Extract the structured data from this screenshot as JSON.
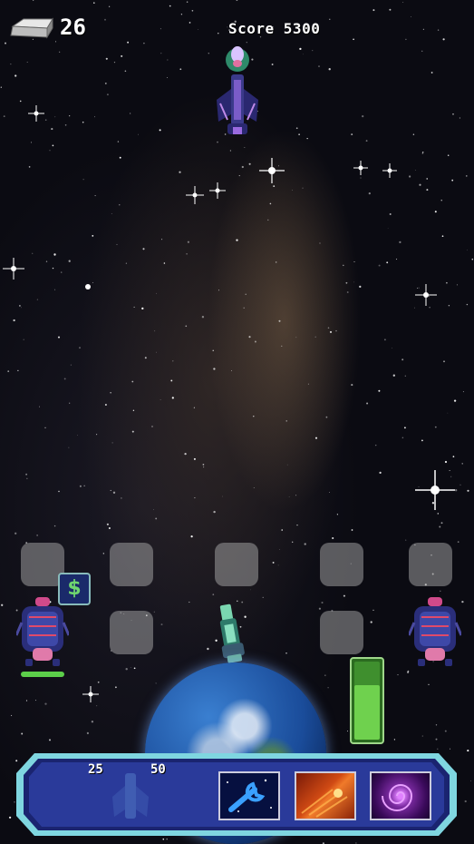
{
  "hud": {
    "silver_icon": "silver-bar-icon",
    "silver_count": "26",
    "score_text": "Score 5300"
  },
  "board": {
    "slots_row1": 5,
    "slots_row2": 3,
    "money_badge": "$",
    "base_health_fraction": 1.0,
    "energy_fraction": 0.72
  },
  "panel": {
    "costs": [
      "25",
      "50"
    ],
    "abilities": [
      {
        "name": "wrench-repair",
        "icon": "wrench-icon"
      },
      {
        "name": "fire-blast",
        "icon": "fire-icon"
      },
      {
        "name": "black-hole",
        "icon": "vortex-icon"
      }
    ]
  },
  "colors": {
    "panel_border": "#7fd6e0",
    "panel_fill": "#2a3a9a",
    "energy": "#6fd14e"
  }
}
